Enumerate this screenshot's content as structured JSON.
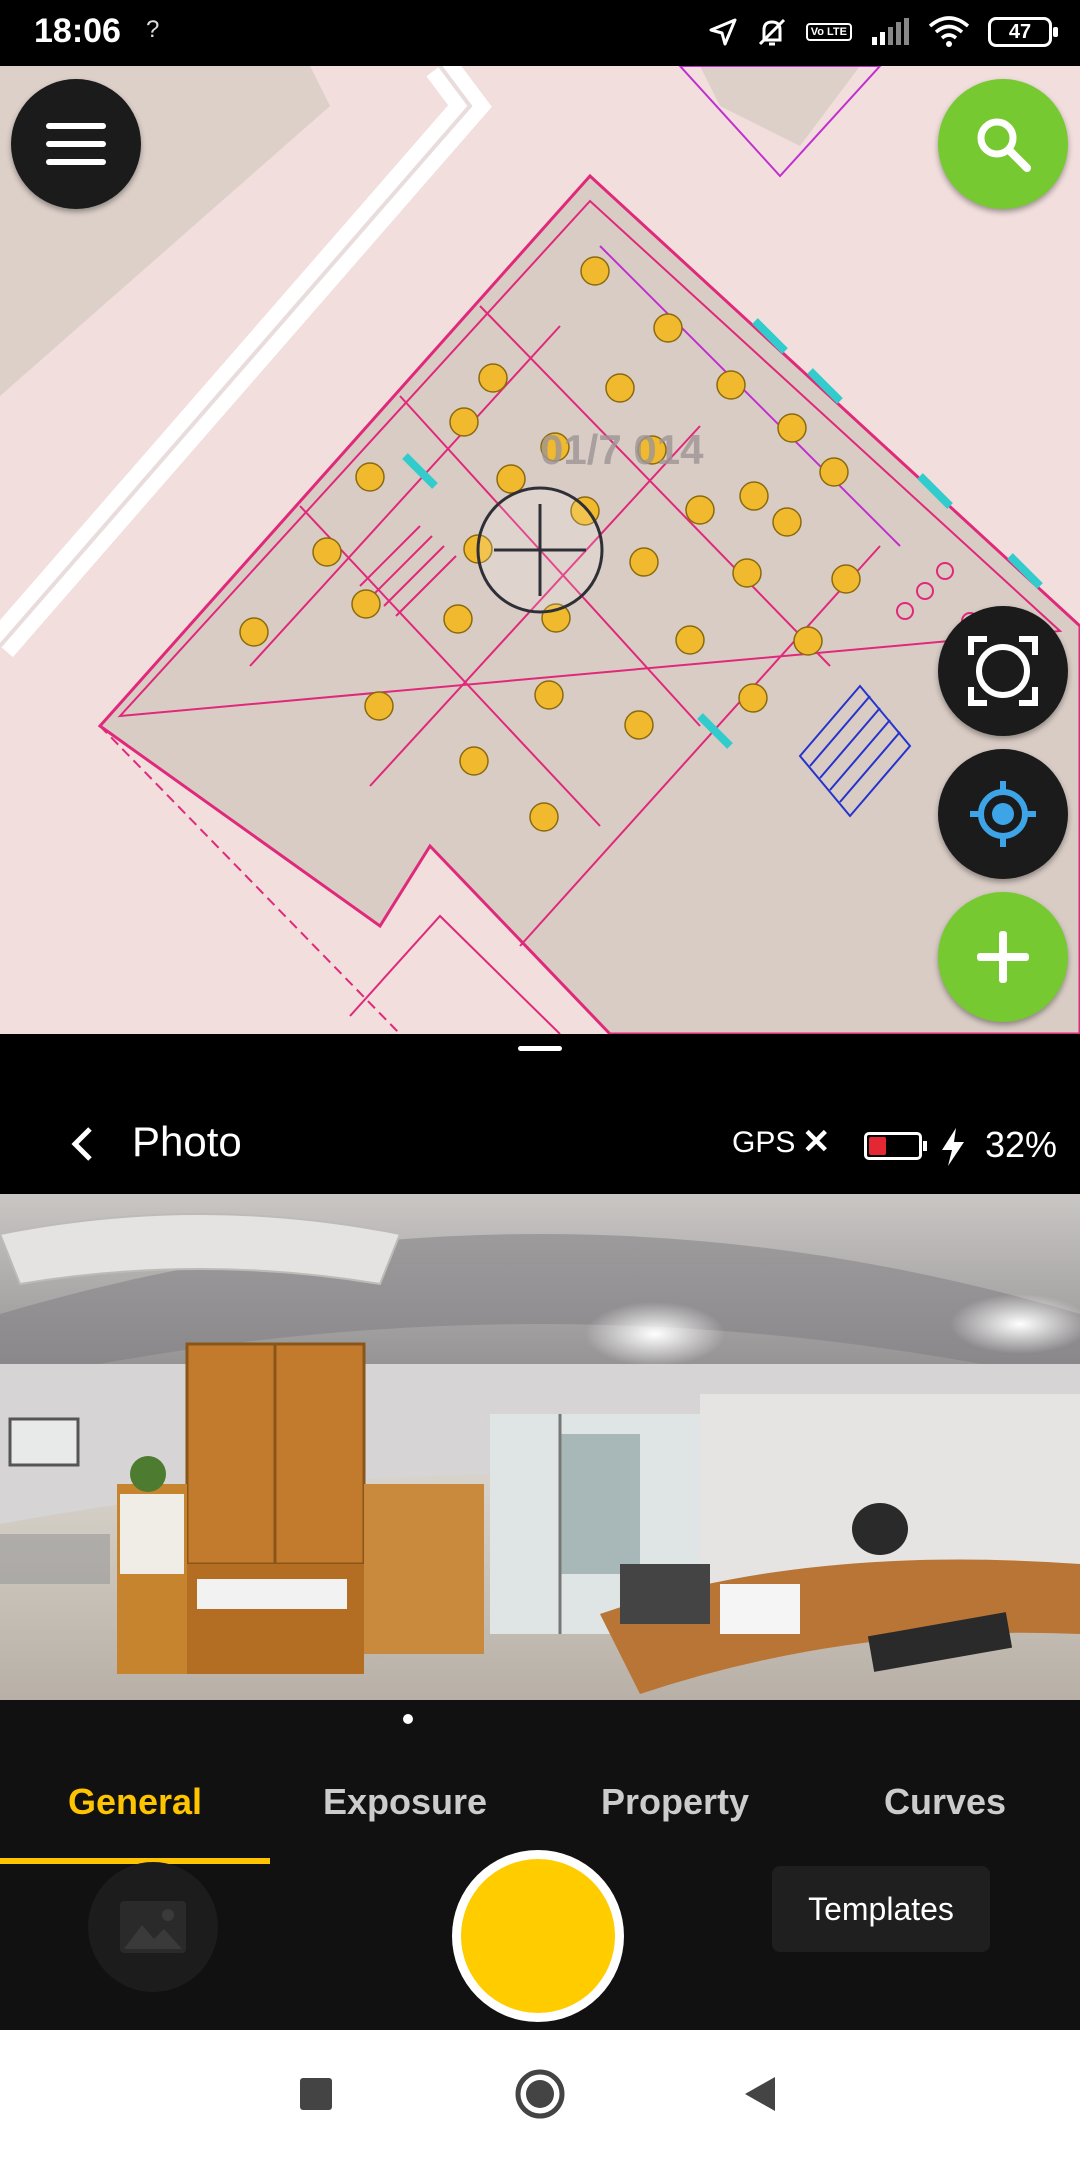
{
  "status_bar": {
    "time": "18:06",
    "unknown_indicator": "?",
    "volte": "Vo LTE",
    "battery_level": "47"
  },
  "map": {
    "label": "01/7 014",
    "colors": {
      "background": "#f1dedd",
      "building": "#d9ccc5",
      "plan_lines": "#e0297a",
      "marker": "#f0b92e"
    },
    "icons": [
      "menu-icon",
      "search-icon",
      "crosshair-icon",
      "fit-screen-icon",
      "my-location-icon",
      "add-icon"
    ]
  },
  "photo_panel": {
    "title": "Photo",
    "gps_label": "GPS",
    "gps_status": "✕",
    "battery_percent": "32%",
    "battery_fraction": 0.32
  },
  "tabs": [
    {
      "label": "General",
      "active": true
    },
    {
      "label": "Exposure",
      "active": false
    },
    {
      "label": "Property",
      "active": false
    },
    {
      "label": "Curves",
      "active": false
    }
  ],
  "controls": {
    "templates_label": "Templates"
  },
  "colors": {
    "accent": "#ffc400",
    "fab_green": "#77c932",
    "fab_dark": "#1b1b1b"
  }
}
